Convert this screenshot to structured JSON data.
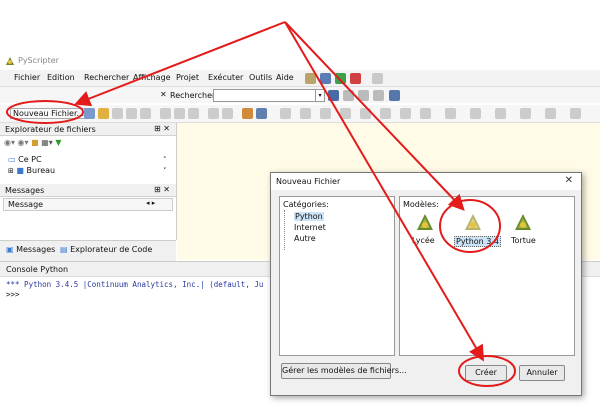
{
  "window": {
    "title": "PyScripter"
  },
  "menu": [
    "Fichier",
    "Edition",
    "Rechercher",
    "Affichage",
    "Projet",
    "Exécuter",
    "Outils",
    "Aide"
  ],
  "search": {
    "label": "Rechercher:",
    "value": ""
  },
  "toolbar": {
    "new_file_label": "Nouveau Fichier..."
  },
  "file_explorer": {
    "title": "Explorateur de fichiers",
    "items": [
      "Ce PC",
      "Bureau"
    ]
  },
  "messages_pane": {
    "title": "Messages",
    "column": "Message"
  },
  "bottom_tabs": [
    "Messages",
    "Explorateur de Code"
  ],
  "console": {
    "title": "Console Python",
    "lines": [
      "*** Python 3.4.5 |Continuum Analytics, Inc.| (default, Ju",
      ">>>"
    ]
  },
  "dialog": {
    "title": "Nouveau Fichier",
    "categories_label": "Catégories:",
    "categories": [
      "Python",
      "Internet",
      "Autre"
    ],
    "models_label": "Modèles:",
    "models": [
      "Lycée",
      "Python 3.4",
      "Tortue"
    ],
    "manage_button": "Gérer les modèles de fichiers...",
    "create_button": "Créer",
    "cancel_button": "Annuler"
  },
  "colors": {
    "highlight_red": "#e31b1b",
    "editor_bg": "#fffbe6",
    "selection_blue": "#cce4f7"
  }
}
